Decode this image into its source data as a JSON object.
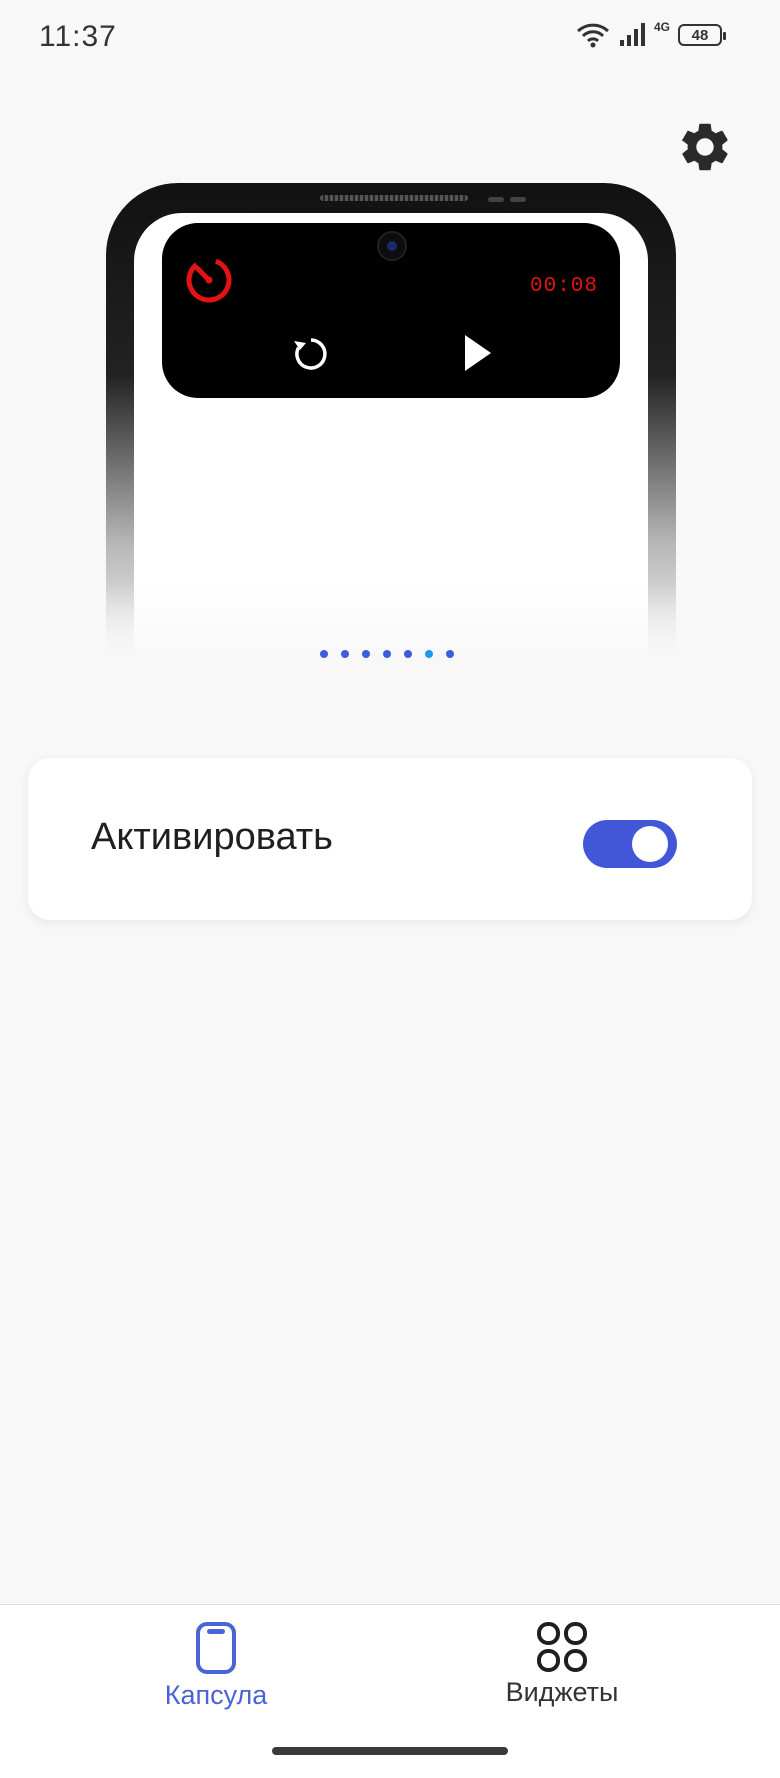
{
  "status_bar": {
    "time": "11:37",
    "network": "4G",
    "battery": "48",
    "icons": [
      "wifi-icon",
      "signal-icon",
      "battery-icon"
    ]
  },
  "preview": {
    "timer_value": "00:08",
    "icons": [
      "timer-icon",
      "reset-icon",
      "play-icon"
    ],
    "page_count": 7,
    "active_page": 6
  },
  "card": {
    "label": "Активировать",
    "toggle_on": true
  },
  "bottom_nav": {
    "items": [
      {
        "label": "Капсула",
        "icon": "capsule-icon",
        "selected": true
      },
      {
        "label": "Виджеты",
        "icon": "widgets-icon",
        "selected": false
      }
    ]
  },
  "colors": {
    "accent": "#4257d8",
    "accent_text": "#4a63d6",
    "timer_red": "#e31313",
    "dot": "#3e5bd9",
    "dot_active": "#1a9be9",
    "background": "#f8f8f8"
  }
}
